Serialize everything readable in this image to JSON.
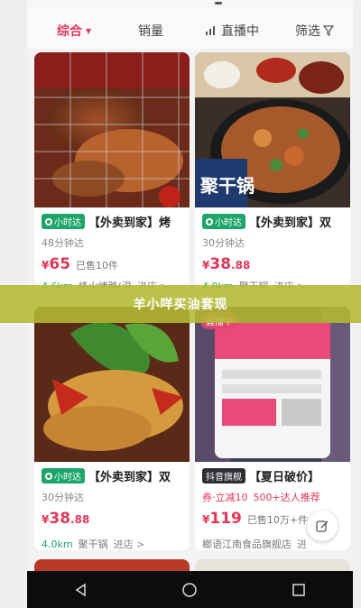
{
  "filters": {
    "comprehensive": "综合",
    "sales": "销量",
    "live": "直播中",
    "filter": "筛选"
  },
  "banner": {
    "text": "羊小咩买油套现"
  },
  "cards": [
    {
      "tag": "小时达",
      "title": "【外卖到家】烤",
      "delivery_time": "48分钟达",
      "price_symbol": "¥",
      "price_int": "65",
      "price_dec": "",
      "sold": "已售10件",
      "distance": "4.6km",
      "shop": "烽火烤路(温",
      "enter": "进店 >"
    },
    {
      "tag": "小时达",
      "title": "【外卖到家】双",
      "delivery_time": "30分钟达",
      "price_symbol": "¥",
      "price_int": "38",
      "price_dec": ".88",
      "sold": "",
      "distance": "4.0km",
      "shop": "聚干锅",
      "enter": "进店 >",
      "image_text": "聚干锅"
    },
    {
      "tag": "小时达",
      "title": "【外卖到家】双",
      "delivery_time": "30分钟达",
      "price_symbol": "¥",
      "price_int": "38",
      "price_dec": ".88",
      "sold": "",
      "distance": "4.0km",
      "shop": "聚干锅",
      "enter": "进店 >"
    },
    {
      "tag": "抖音旗舰",
      "title": "【夏日破价】",
      "promo_coupon": "券·立减10",
      "promo_text": "500+达人推荐",
      "price_symbol": "¥",
      "price_int": "119",
      "price_dec": "",
      "sold": "已售10万+件",
      "shop": "榔语江南食品旗舰店",
      "enter": "进",
      "live_label": "直播中"
    }
  ],
  "colors": {
    "accent": "#e0385b",
    "green": "#1da56a",
    "banner": "#b4b932"
  },
  "icons": [
    "filter-funnel-icon",
    "live-bars-icon",
    "location-pin-icon",
    "back-nav-icon",
    "home-nav-icon",
    "recent-apps-icon",
    "edit-note-icon"
  ]
}
